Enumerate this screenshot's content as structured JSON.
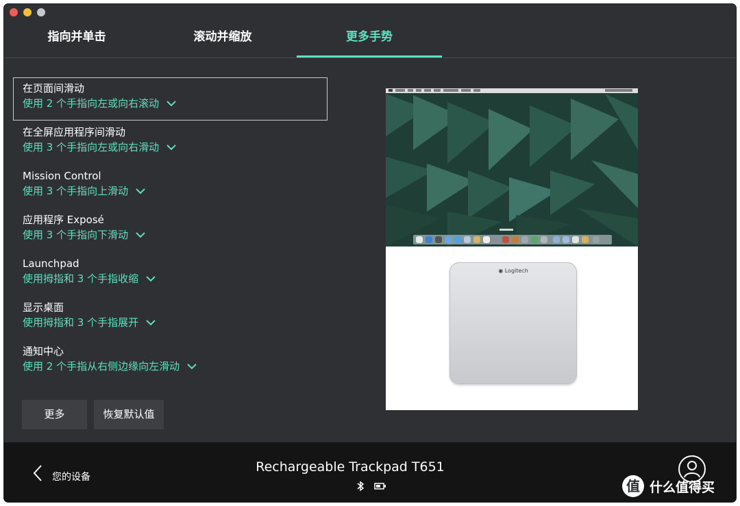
{
  "tabs": [
    {
      "label": "指向并单击",
      "active": false
    },
    {
      "label": "滚动并缩放",
      "active": false
    },
    {
      "label": "更多手势",
      "active": true
    }
  ],
  "gestures": [
    {
      "title": "在页面间滑动",
      "action": "使用 2 个手指向左或向右滚动"
    },
    {
      "title": "在全屏应用程序间滑动",
      "action": "使用 3 个手指向左或向右滑动"
    },
    {
      "title": "Mission Control",
      "action": "使用 3 个手指向上滑动"
    },
    {
      "title": "应用程序 Exposé",
      "action": "使用 3 个手指向下滑动"
    },
    {
      "title": "Launchpad",
      "action": "使用拇指和 3 个手指收缩"
    },
    {
      "title": "显示桌面",
      "action": "使用拇指和 3 个手指展开"
    },
    {
      "title": "通知中心",
      "action": "使用 2 个手指从右侧边缘向左滑动"
    }
  ],
  "buttons": {
    "more": "更多",
    "reset": "恢复默认值"
  },
  "preview": {
    "trackpad_brand": "Logitech"
  },
  "footer": {
    "back_label": "您的设备",
    "device_name": "Rechargeable Trackpad T651",
    "status_icons": [
      "bluetooth-icon",
      "battery-icon"
    ]
  },
  "watermark": {
    "symbol": "值",
    "text": "什么值得买"
  },
  "colors": {
    "accent": "#5ee0c1",
    "background": "#2e3033",
    "footer": "#141414"
  }
}
